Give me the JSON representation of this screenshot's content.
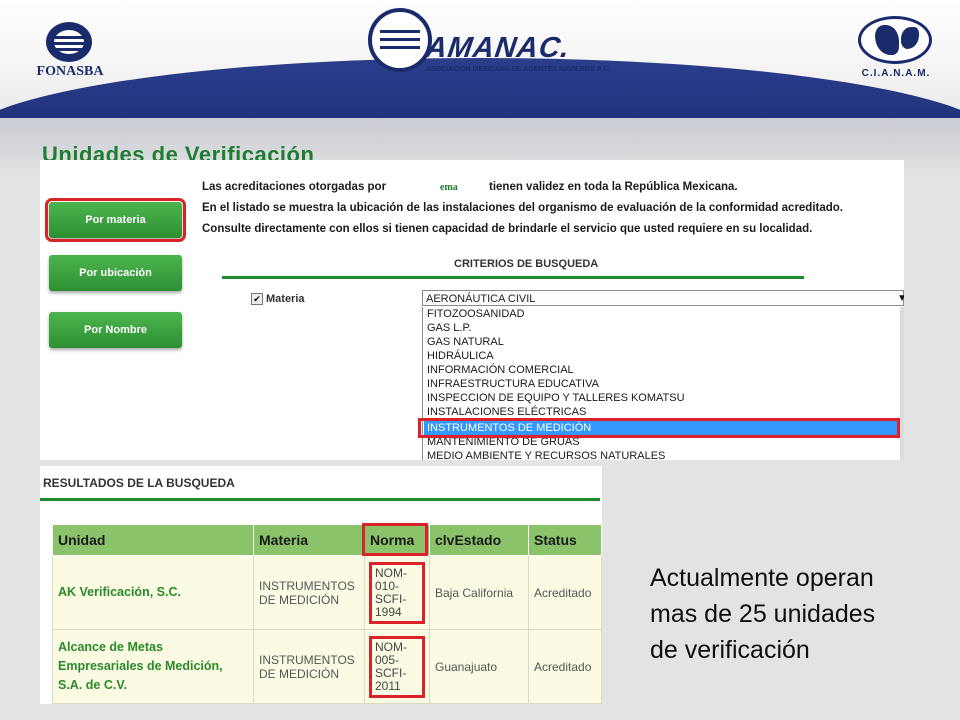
{
  "header": {
    "fonasba_text": "FONASBA",
    "amanac_text": "AMANAC.",
    "amanac_sub": "ASOCIACION MEXICANA DE AGENTES NAVIEROS A.C.",
    "cianam_text": "C.I.A.N.A.M."
  },
  "title": "Unidades de Verificación",
  "sidebar": {
    "buttons": [
      "Por materia",
      "Por ubicación",
      "Por Nombre"
    ]
  },
  "info": {
    "line1_a": "Las acreditaciones otorgadas por",
    "ema": "ema",
    "line1_b": "tienen validez en toda la República Mexicana.",
    "line2": "En el listado se muestra la ubicación de las instalaciones del organismo de evaluación de la conformidad acreditado.",
    "line3": "Consulte directamente con ellos si tienen capacidad de brindarle el servicio que usted requiere en su localidad."
  },
  "search": {
    "heading": "CRITERIOS DE BUSQUEDA",
    "materia_label": "Materia",
    "materia_checked": true,
    "select_value": "AERONÁUTICA CIVIL",
    "options": [
      "FITOZOOSANIDAD",
      "GAS L.P.",
      "GAS NATURAL",
      "HIDRÁULICA",
      "INFORMACIÓN COMERCIAL",
      "INFRAESTRUCTURA EDUCATIVA",
      "INSPECCION DE EQUIPO Y TALLERES KOMATSU",
      "INSTALACIONES ELÉCTRICAS",
      "INSTRUMENTOS DE MEDICIÓN",
      "MANTENIMIENTO DE GRUAS",
      "MEDIO AMBIENTE Y RECURSOS NATURALES"
    ],
    "selected_index": 8
  },
  "results": {
    "heading": "RESULTADOS DE LA BUSQUEDA",
    "columns": [
      "Unidad",
      "Materia",
      "Norma",
      "clvEstado",
      "Status"
    ],
    "rows": [
      {
        "unidad": [
          "AK Verificación, S.C."
        ],
        "materia": [
          "INSTRUMENTOS",
          "DE MEDICIÓN"
        ],
        "norma": [
          "NOM-",
          "010-",
          "SCFI-",
          "1994"
        ],
        "estado": "Baja California",
        "status": "Acreditado"
      },
      {
        "unidad": [
          "Alcance de Metas",
          "Empresariales de Medición,",
          "S.A. de C.V."
        ],
        "materia": [
          "INSTRUMENTOS",
          "DE MEDICIÓN"
        ],
        "norma": [
          "NOM-",
          "005-",
          "SCFI-",
          "2011"
        ],
        "estado": "Guanajuato",
        "status": "Acreditado"
      }
    ]
  },
  "note": {
    "line1": "Actualmente operan",
    "line2": "mas de 25 unidades",
    "line3": "de verificación"
  },
  "colors": {
    "accent_green": "#1f7d32",
    "highlight_red": "#d9222a",
    "selection_blue": "#3399ff",
    "navy": "#1a2b6b"
  }
}
